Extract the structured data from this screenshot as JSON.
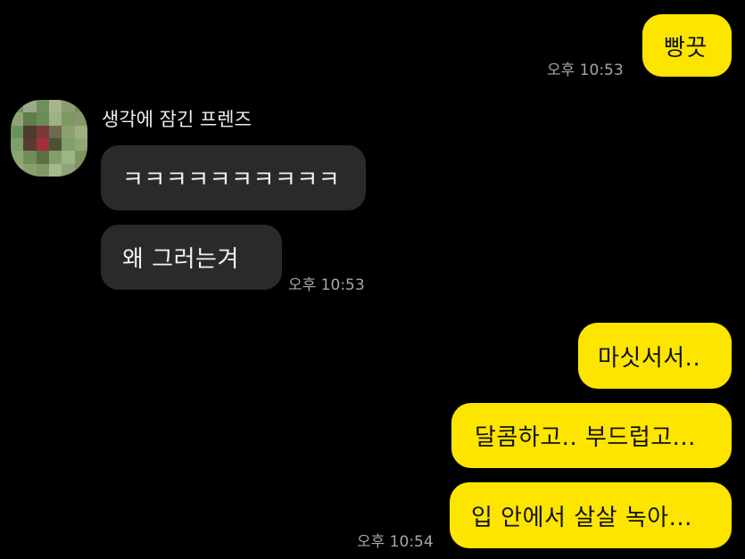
{
  "theme": {
    "background": "#000000",
    "my_bubble": "#FEE500",
    "their_bubble": "#2A2A2A",
    "timestamp_color": "#A6A6A6"
  },
  "messages": {
    "m1": {
      "text": "빵끗",
      "time": "오후 10:53"
    },
    "sender_name": "생각에 잠긴 프렌즈",
    "avatar_icon": "pixelated-avatar-icon",
    "m2": {
      "text": "ㅋㅋㅋㅋㅋㅋㅋㅋㅋㅋ"
    },
    "m3": {
      "text": "왜 그러는겨",
      "time": "오후 10:53"
    },
    "m4": {
      "text": "마싯서서.."
    },
    "m5": {
      "text": "달콤하고.. 부드럽고..."
    },
    "m6": {
      "text": "입 안에서 살살 녹아...",
      "time": "오후 10:54"
    }
  }
}
